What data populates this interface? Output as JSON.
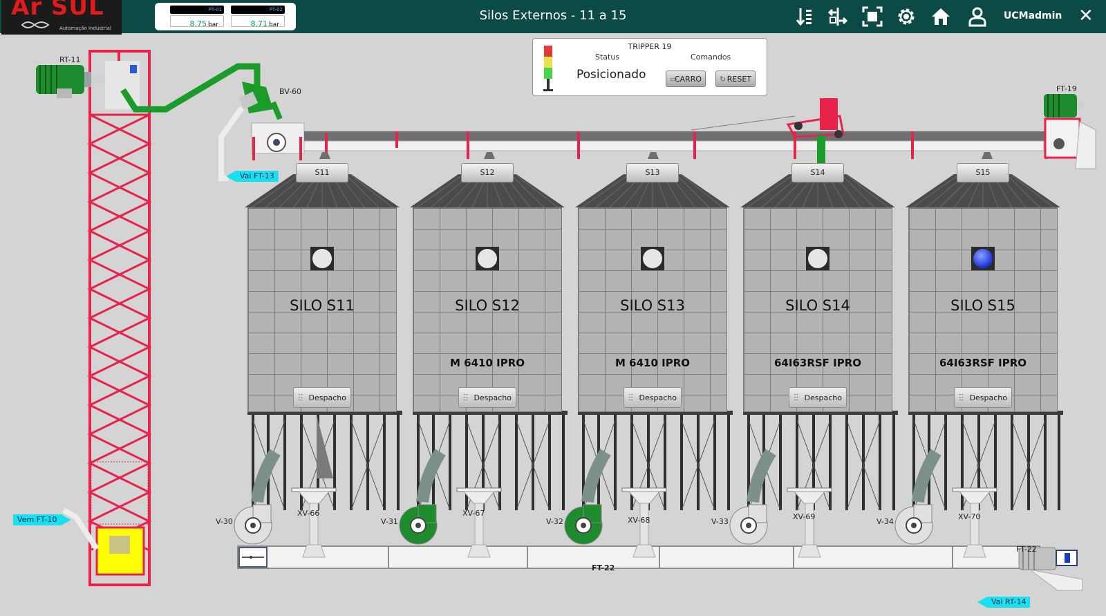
{
  "header": {
    "brand": "Ar SUL",
    "brand_tagline": "Automação Industrial",
    "title": "Silos Externos - 11 a 15",
    "user": "UCMadmin",
    "close": "✕",
    "icons": [
      "sort-icon",
      "swap-icon",
      "fullscreen-icon",
      "gear-icon",
      "home-icon",
      "user-icon",
      "close-icon"
    ]
  },
  "pressures": [
    {
      "tag": "PT-01",
      "value": "8.75",
      "unit": "bar"
    },
    {
      "tag": "PT-02",
      "value": "8.71",
      "unit": "bar"
    }
  ],
  "tripper": {
    "title": "TRIPPER 19",
    "status_label": "Status",
    "commands_label": "Comandos",
    "status": "Posicionado",
    "btn_carro": "CARRO",
    "btn_reset": "RESET"
  },
  "equipment": {
    "rt11": "RT-11",
    "bv60": "BV-60",
    "ft19": "FT-19",
    "ft22": "FT-22",
    "ft22_top": "FT-22",
    "vai_ft13": "Vai FT-13",
    "vem_ft10": "Vem FT-10",
    "vai_rt14": "Vai RT-14"
  },
  "silos": [
    {
      "tag": "S11",
      "name": "SILO S11",
      "product": "",
      "lamp_on": false,
      "dispatch": "Despacho",
      "fan": "V-30",
      "valve": "XV-66",
      "fan_running": false
    },
    {
      "tag": "S12",
      "name": "SILO S12",
      "product": "M 6410 IPRO",
      "lamp_on": false,
      "dispatch": "Despacho",
      "fan": "V-31",
      "valve": "XV-67",
      "fan_running": true
    },
    {
      "tag": "S13",
      "name": "SILO S13",
      "product": "M 6410 IPRO",
      "lamp_on": false,
      "dispatch": "Despacho",
      "fan": "V-32",
      "valve": "XV-68",
      "fan_running": true
    },
    {
      "tag": "S14",
      "name": "SILO S14",
      "product": "64I63RSF IPRO",
      "lamp_on": false,
      "dispatch": "Despacho",
      "fan": "V-33",
      "valve": "XV-69",
      "fan_running": false
    },
    {
      "tag": "S15",
      "name": "SILO S15",
      "product": "64I63RSF IPRO",
      "lamp_on": true,
      "dispatch": "Despacho",
      "fan": "V-34",
      "valve": "XV-70",
      "fan_running": false
    }
  ],
  "colors": {
    "header": "#0c4a45",
    "background": "#d4d4d4",
    "structure_red": "#e8234a",
    "running_green": "#1e8c2e",
    "label_cyan": "#18e0f0",
    "lamp_on": "#1a2fd6"
  }
}
